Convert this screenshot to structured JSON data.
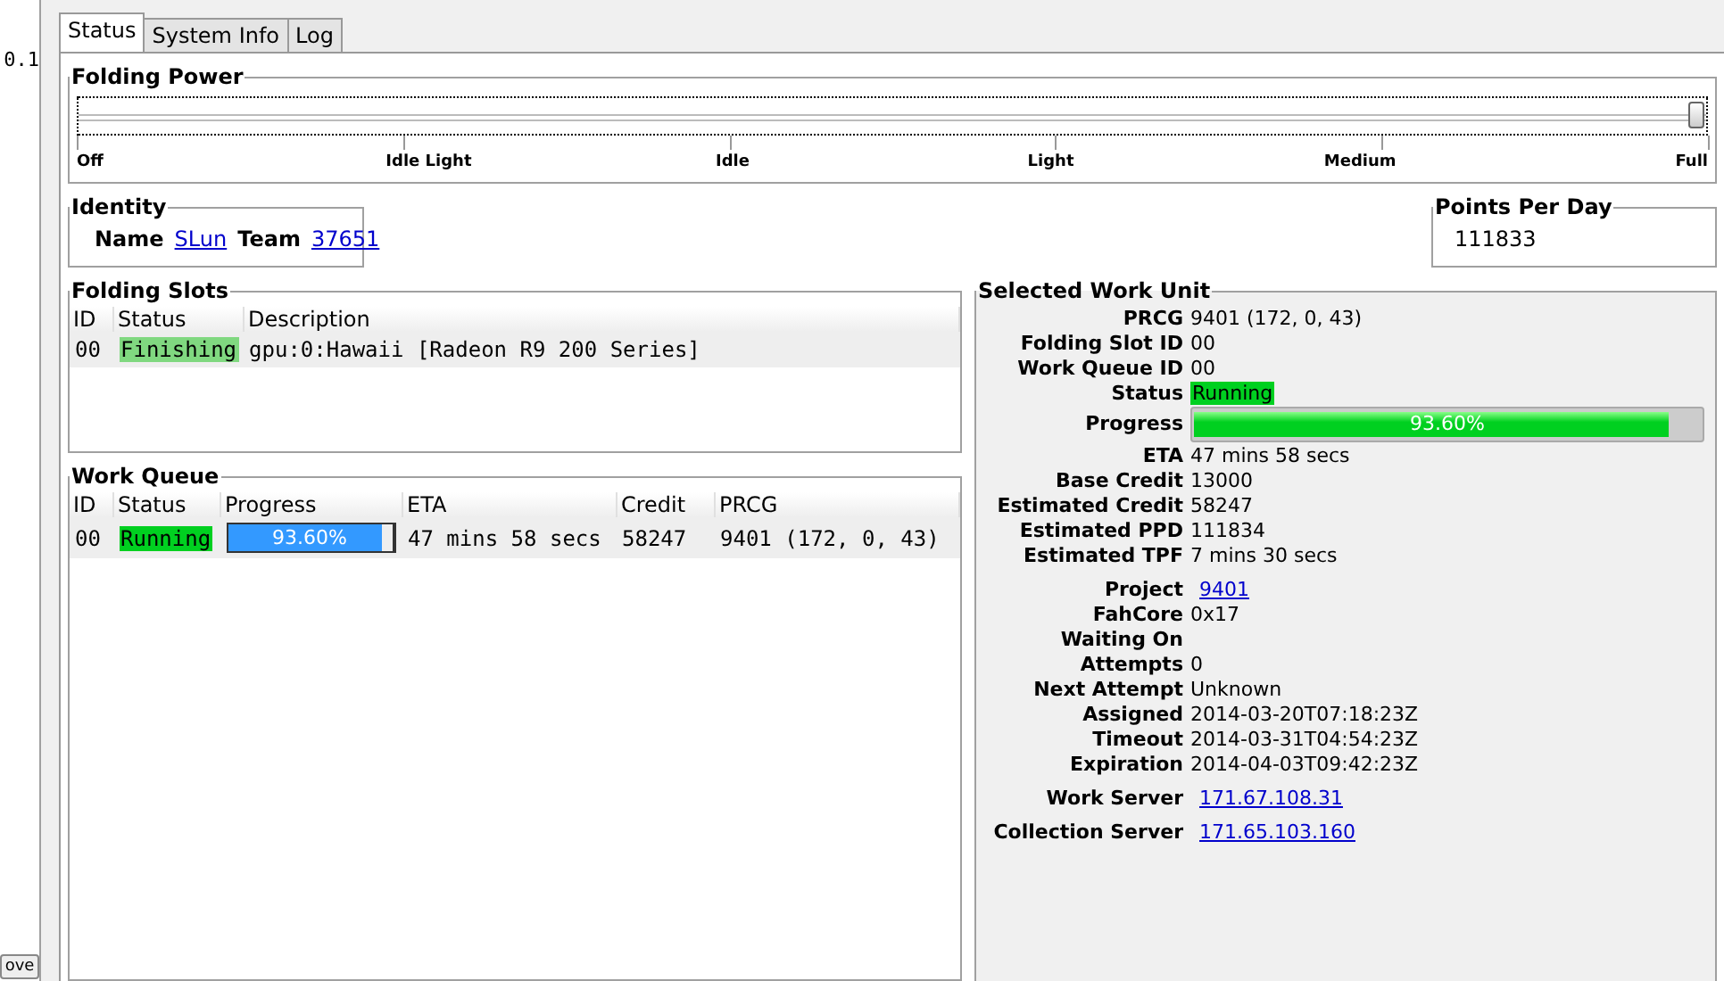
{
  "left_pane": {
    "text": "0.1",
    "button": "ove"
  },
  "tabs": [
    {
      "label": "Status",
      "selected": true
    },
    {
      "label": "System Info",
      "selected": false
    },
    {
      "label": "Log",
      "selected": false
    }
  ],
  "folding_power": {
    "title": "Folding Power",
    "level": 1,
    "ticks": [
      "Off",
      "Idle Light",
      "Idle",
      "Light",
      "Medium",
      "Full"
    ]
  },
  "identity": {
    "title": "Identity",
    "name_label": "Name",
    "name": "SLun",
    "team_label": "Team",
    "team": "37651"
  },
  "points_per_day": {
    "title": "Points Per Day",
    "value": "111833"
  },
  "folding_slots": {
    "title": "Folding Slots",
    "columns": [
      "ID",
      "Status",
      "Description"
    ],
    "rows": [
      {
        "id": "00",
        "status": "Finishing",
        "color": "#80d880",
        "description": "gpu:0:Hawaii [Radeon R9 200 Series]"
      }
    ]
  },
  "work_queue": {
    "title": "Work Queue",
    "columns": [
      "ID",
      "Status",
      "Progress",
      "ETA",
      "Credit",
      "PRCG"
    ],
    "rows": [
      {
        "id": "00",
        "status": "Running",
        "color": "#00d020",
        "progress": {
          "level": 0.936,
          "text": "93.60%"
        },
        "eta": "47 mins 58 secs",
        "credit": "58247",
        "prcg": "9401 (172, 0, 43)"
      }
    ]
  },
  "selected_work_unit": {
    "title": "Selected Work Unit",
    "fields": [
      {
        "kind": "text",
        "label": "PRCG",
        "value": "9401 (172, 0, 43)"
      },
      {
        "kind": "text",
        "label": "Folding Slot ID",
        "value": "00"
      },
      {
        "kind": "text",
        "label": "Work Queue ID",
        "value": "00"
      },
      {
        "kind": "status",
        "label": "Status",
        "value": "Running",
        "color": "#00d020"
      },
      {
        "kind": "progress",
        "label": "Progress",
        "value": "93.60%",
        "level": 0.936
      },
      {
        "kind": "text",
        "label": "ETA",
        "value": "47 mins 58 secs"
      },
      {
        "kind": "text",
        "label": "Base Credit",
        "value": "13000"
      },
      {
        "kind": "text",
        "label": "Estimated Credit",
        "value": "58247"
      },
      {
        "kind": "text",
        "label": "Estimated PPD",
        "value": "111834"
      },
      {
        "kind": "text",
        "label": "Estimated TPF",
        "value": "7 mins 30 secs"
      },
      {
        "kind": "link",
        "label": "Project",
        "value": "9401"
      },
      {
        "kind": "text",
        "label": "FahCore",
        "value": "0x17"
      },
      {
        "kind": "text",
        "label": "Waiting On"
      },
      {
        "kind": "text",
        "label": "Attempts",
        "value": "0"
      },
      {
        "kind": "text",
        "label": "Next Attempt",
        "value": "Unknown"
      },
      {
        "kind": "text",
        "label": "Assigned",
        "value": "2014-03-20T07:18:23Z"
      },
      {
        "kind": "text",
        "label": "Timeout",
        "value": "2014-03-31T04:54:23Z"
      },
      {
        "kind": "text",
        "label": "Expiration",
        "value": "2014-04-03T09:42:23Z"
      },
      {
        "kind": "link",
        "label": "Work Server",
        "value": "171.67.108.31"
      },
      {
        "kind": "link",
        "label": "Collection Server",
        "value": "171.65.103.160"
      }
    ]
  }
}
